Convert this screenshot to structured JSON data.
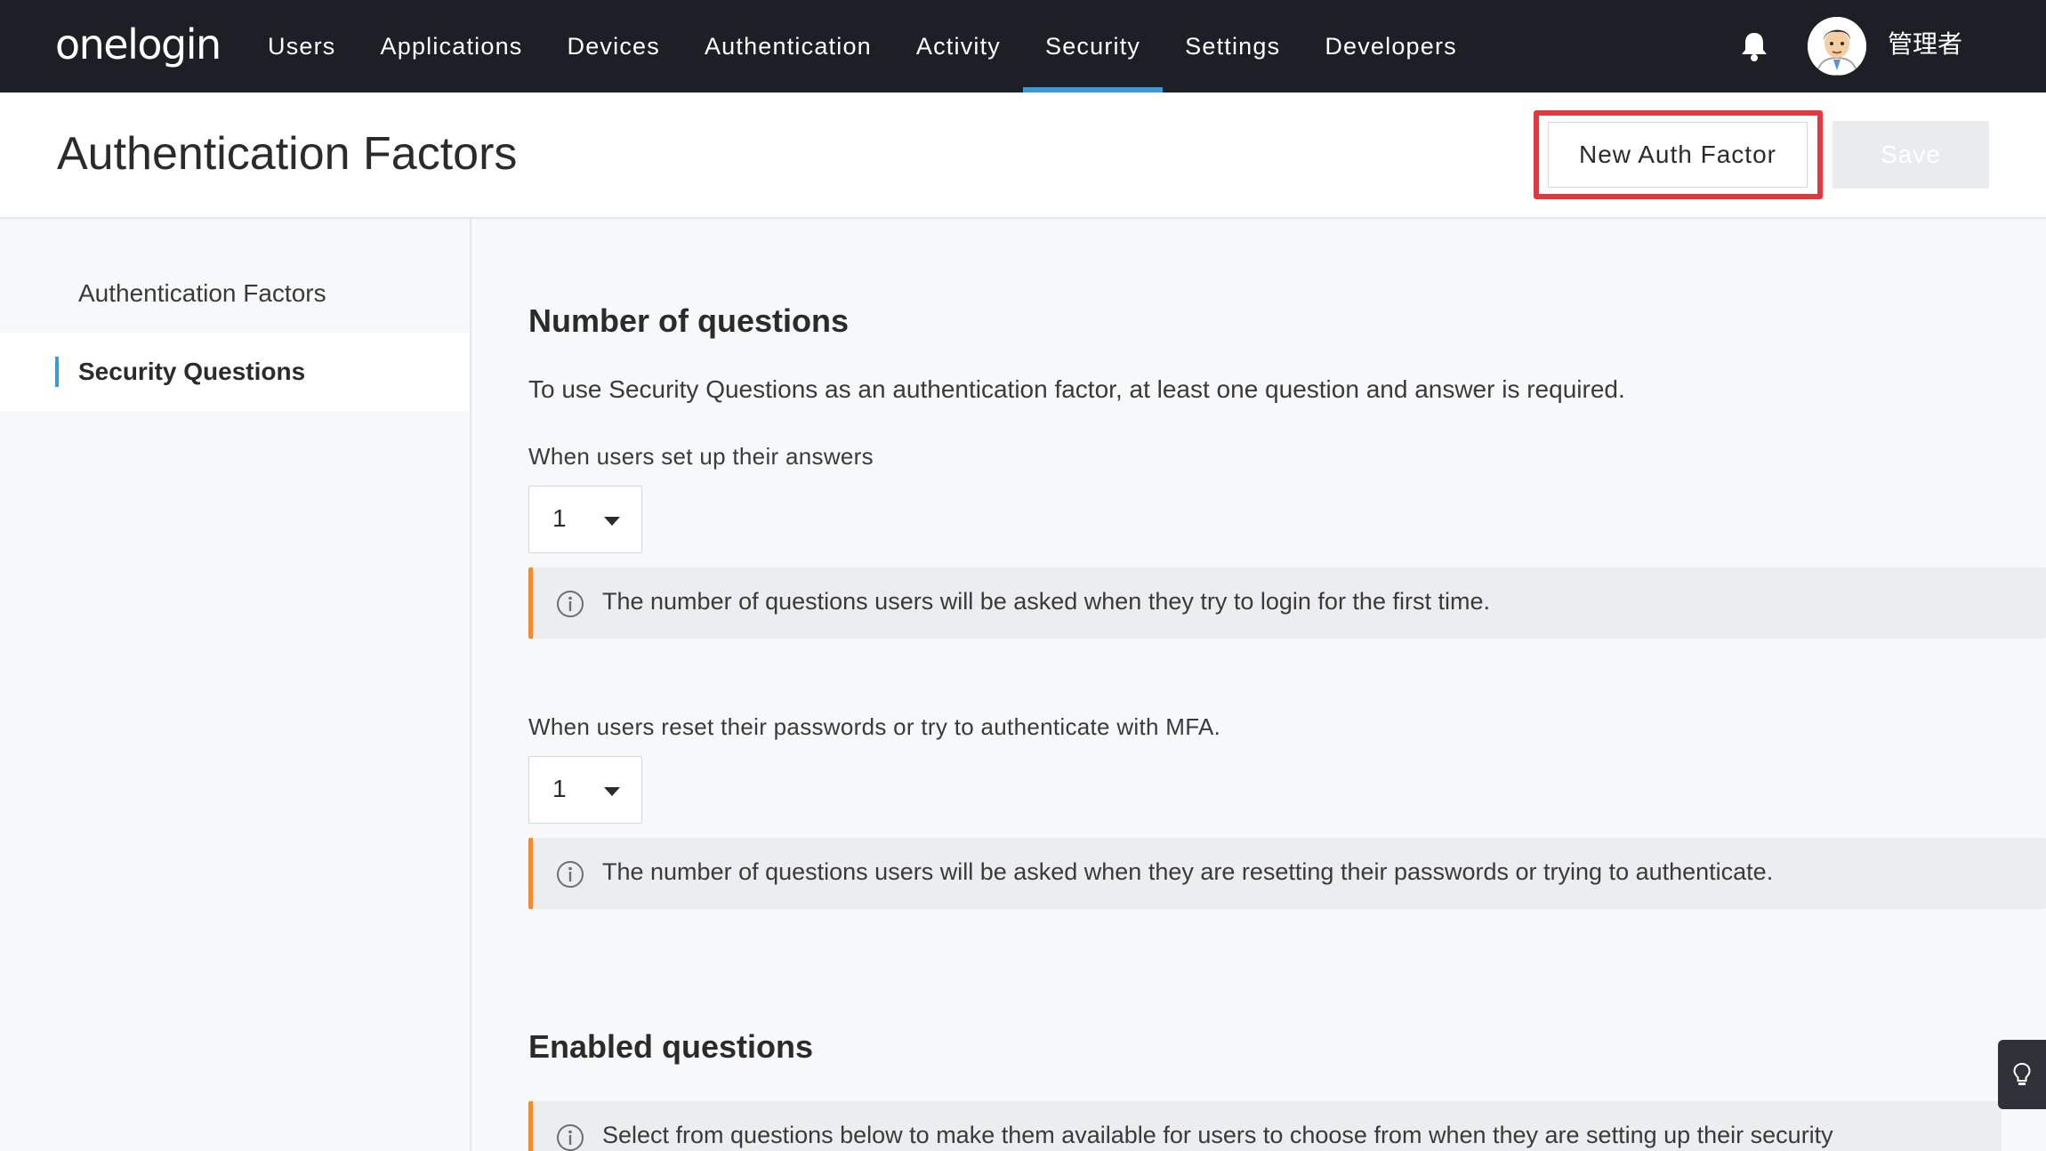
{
  "topnav": {
    "logo": "onelogin",
    "items": [
      {
        "label": "Users"
      },
      {
        "label": "Applications"
      },
      {
        "label": "Devices"
      },
      {
        "label": "Authentication"
      },
      {
        "label": "Activity"
      },
      {
        "label": "Security",
        "active": true
      },
      {
        "label": "Settings"
      },
      {
        "label": "Developers"
      }
    ],
    "notification_icon": "bell-icon",
    "avatar_icon": "user-avatar",
    "username": "管理者",
    "active_color": "#3c99d6",
    "background": "#1c2026"
  },
  "header": {
    "title": "Authentication Factors",
    "new_button_label": "New Auth Factor",
    "save_button_label": "Save",
    "highlight_color": "#e0393e"
  },
  "sidebar": {
    "items": [
      {
        "label": "Authentication Factors"
      },
      {
        "label": "Security Questions",
        "active": true
      }
    ]
  },
  "main": {
    "section1_title": "Number of questions",
    "section1_desc": "To use Security Questions as an authentication factor, at least one question and answer is required.",
    "setup": {
      "label": "When users set up their answers",
      "value": "1",
      "info": "The number of questions users will be asked when they try to login for the first time."
    },
    "reset": {
      "label": "When users reset their passwords or try to authenticate with MFA.",
      "value": "1",
      "info": "The number of questions users will be asked when they are resetting their passwords or trying to authenticate."
    },
    "section2_title": "Enabled questions",
    "enabled_info": "Select from questions below to make them available for users to choose from when they are setting up their security",
    "info_accent": "#ef8c33"
  },
  "help_tab_icon": "lightbulb-icon"
}
